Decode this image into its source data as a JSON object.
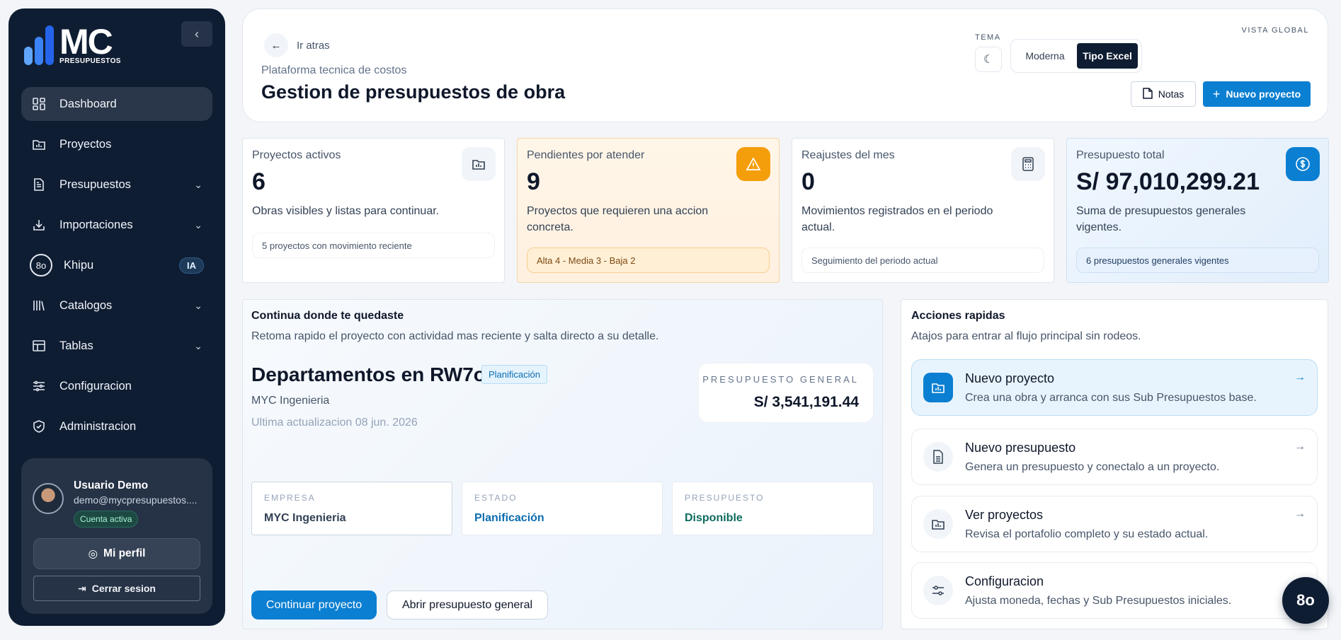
{
  "sidebar": {
    "logo": {
      "mark": "MC",
      "sub": "PRESUPUESTOS"
    },
    "items": [
      {
        "label": "Dashboard"
      },
      {
        "label": "Proyectos"
      },
      {
        "label": "Presupuestos"
      },
      {
        "label": "Importaciones"
      },
      {
        "label": "Khipu",
        "badge": "IA"
      },
      {
        "label": "Catalogos"
      },
      {
        "label": "Tablas"
      },
      {
        "label": "Configuracion"
      },
      {
        "label": "Administracion"
      }
    ],
    "user": {
      "name": "Usuario Demo",
      "email": "demo@mycpresupuestos....",
      "status": "Cuenta activa",
      "profile_label": "Mi perfil",
      "logout_label": "Cerrar sesion"
    }
  },
  "header": {
    "back_label": "Ir atras",
    "subtitle": "Plataforma tecnica de costos",
    "title": "Gestion de presupuestos de obra",
    "tema_label": "TEMA",
    "vista_label": "VISTA GLOBAL",
    "vista_options": [
      "Moderna",
      "Tipo Excel"
    ],
    "vista_selected": "Tipo Excel",
    "notas_label": "Notas",
    "nuevo_label": "Nuevo proyecto"
  },
  "stats": [
    {
      "label": "Proyectos activos",
      "value": "6",
      "desc": "Obras visibles y listas para continuar.",
      "chip": "5 proyectos con movimiento reciente",
      "icon": "folder-chart-icon"
    },
    {
      "label": "Pendientes por atender",
      "value": "9",
      "desc": "Proyectos que requieren una accion concreta.",
      "chip": "Alta 4 - Media 3 - Baja 2",
      "icon": "warning-icon"
    },
    {
      "label": "Reajustes del mes",
      "value": "0",
      "desc": "Movimientos registrados en el periodo actual.",
      "chip": "Seguimiento del periodo actual",
      "icon": "calculator-icon"
    },
    {
      "label": "Presupuesto total",
      "value": "S/ 97,010,299.21",
      "desc": "Suma de presupuestos generales vigentes.",
      "chip": "6 presupuestos generales vigentes",
      "icon": "dollar-icon"
    }
  ],
  "continue": {
    "heading": "Continua donde te quedaste",
    "sub": "Retoma rapido el proyecto con actividad mas reciente y salta directo a su detalle.",
    "project_name": "Departamentos en RW7o",
    "badge": "Planificación",
    "company": "MYC Ingenieria",
    "updated": "Ultima actualizacion 08 jun. 2026",
    "budget_label": "PRESUPUESTO GENERAL",
    "budget_value": "S/ 3,541,191.44",
    "info": [
      {
        "label": "EMPRESA",
        "value": "MYC Ingenieria"
      },
      {
        "label": "ESTADO",
        "value": "Planificación"
      },
      {
        "label": "PRESUPUESTO",
        "value": "Disponible"
      }
    ],
    "primary_label": "Continuar proyecto",
    "secondary_label": "Abrir presupuesto general"
  },
  "quick": {
    "heading": "Acciones rapidas",
    "sub": "Atajos para entrar al flujo principal sin rodeos.",
    "actions": [
      {
        "title": "Nuevo proyecto",
        "desc": "Crea una obra y arranca con sus Sub Presupuestos base."
      },
      {
        "title": "Nuevo presupuesto",
        "desc": "Genera un presupuesto y conectalo a un proyecto."
      },
      {
        "title": "Ver proyectos",
        "desc": "Revisa el portafolio completo y su estado actual."
      },
      {
        "title": "Configuracion",
        "desc": "Ajusta moneda, fechas y Sub Presupuestos iniciales."
      }
    ]
  },
  "colors": {
    "accent": "#0b7fd1",
    "sidebar": "#0f1d33",
    "warning": "#f59e0b"
  }
}
